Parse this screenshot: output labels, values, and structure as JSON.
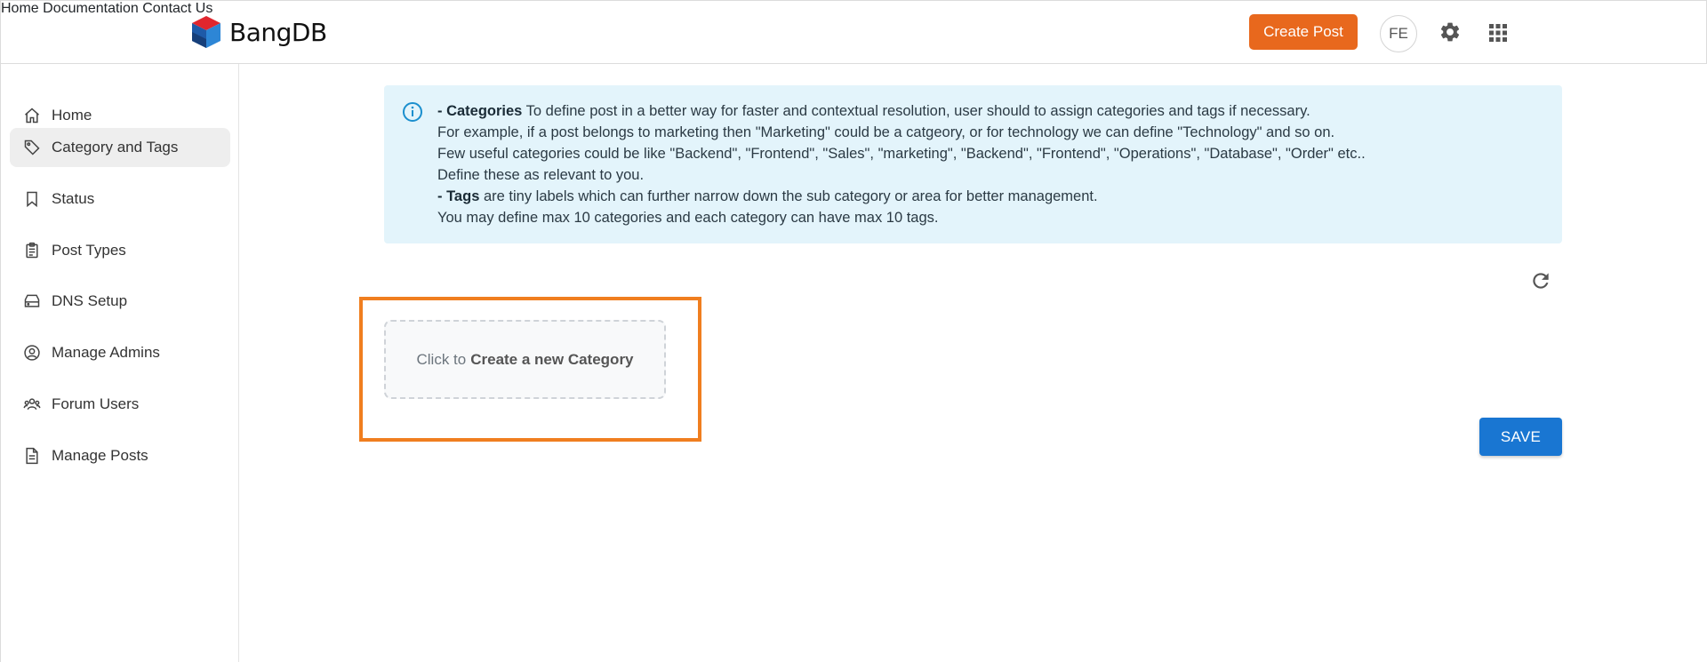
{
  "header": {
    "brand": "BangDB",
    "nav": {
      "home": "Home",
      "documentation": "Documentation",
      "contact": "Contact Us"
    },
    "create_post": "Create Post",
    "avatar_initials": "FE",
    "icons": [
      "gear-icon",
      "apps-grid-icon"
    ],
    "accent_color": "#e8681d"
  },
  "sidebar": {
    "items": [
      {
        "label": "Home",
        "icon": "home-icon"
      },
      {
        "label": "Category and Tags",
        "icon": "tag-icon",
        "active": true
      },
      {
        "label": "Status",
        "icon": "bookmark-icon"
      },
      {
        "label": "Post Types",
        "icon": "clipboard-icon"
      },
      {
        "label": "DNS Setup",
        "icon": "server-icon"
      },
      {
        "label": "Manage Admins",
        "icon": "user-circle-icon"
      },
      {
        "label": "Forum Users",
        "icon": "users-icon"
      },
      {
        "label": "Manage Posts",
        "icon": "document-icon"
      }
    ]
  },
  "info": {
    "categories_label": "- Categories",
    "line1": " To define post in a better way for faster and contextual resolution, user should to assign categories and tags if necessary.",
    "line2": "For example, if a post belongs to marketing then \"Marketing\" could be a catgeory, or for technology we can define \"Technology\" and so on.",
    "line3": "Few useful categories could be like \"Backend\", \"Frontend\", \"Sales\", \"marketing\", \"Backend\", \"Frontend\", \"Operations\", \"Database\", \"Order\" etc..",
    "line4": "Define these as relevant to you.",
    "tags_label": "- Tags",
    "line5": " are tiny labels which can further narrow down the sub category or area for better management.",
    "line6": "You may define max 10 categories and each category can have max 10 tags."
  },
  "category": {
    "prefix": "Click to",
    "action": "Create a new Category"
  },
  "save_label": "SAVE",
  "colors": {
    "info_bg": "#e3f4fb",
    "highlight": "#f07e1f",
    "save": "#1976d2"
  }
}
